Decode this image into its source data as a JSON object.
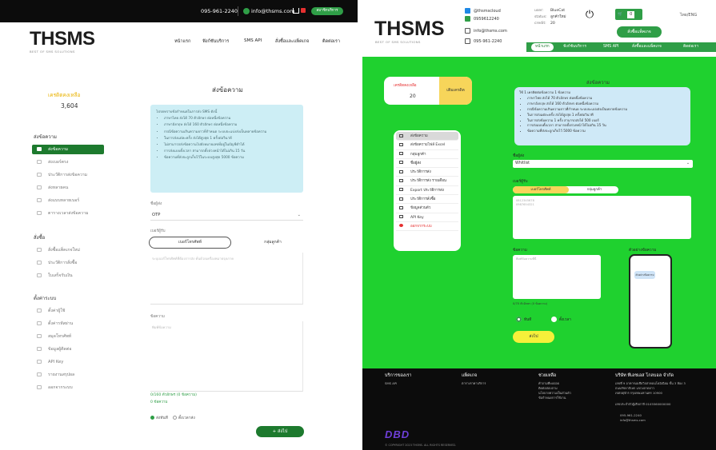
{
  "left": {
    "topbar": {
      "phone": "095-961-2240",
      "email": "info@thsms.com",
      "member_button": "สมาชิกบริการ"
    },
    "logo": "THSMS",
    "tagline": "BEST OF SMS SOLUTIONS",
    "nav": [
      "หน้าแรก",
      "ฟังก์ชันบริการ",
      "SMS API",
      "สั่งซื้อและแพ็คเกจ",
      "ติดต่อเรา"
    ],
    "credit": {
      "label": "เครดิตคงเหลือ",
      "value": "3,604"
    },
    "sidebar": {
      "group1": "ส่งข้อความ",
      "items1": [
        "ส่งข้อความ",
        "ส่งเบอร์ตรง",
        "ประวัติการส่งข้อความ",
        "ส่งหลายคน",
        "ส่งแบบหลายเบอร์",
        "ตารางเวลาส่งข้อความ"
      ],
      "group2": "สั่งซื้อ",
      "items2": [
        "สั่งซื้อแพ็คเกจใหม่",
        "ประวัติการสั่งซื้อ",
        "ใบเสร็จรับเงิน"
      ],
      "group3": "ตั้งค่าระบบ",
      "items3": [
        "ตั้งค่าผู้ใช้",
        "ตั้งค่ารหัสผ่าน",
        "สมุดโทรศัพท์",
        "ข้อมูลผู้ติดต่อ",
        "API Key",
        "รายงานสรุปผล",
        "ออกจากระบบ"
      ]
    },
    "main": {
      "title": "ส่งข้อความ",
      "info_lines": [
        "โปรดทราบข้อกำหนดในการส่ง SMS ดังนี้",
        "ภาษาไทย ส่งได้ 70 ตัวอักษร ต่อหนึ่งข้อความ",
        "ภาษาอังกฤษ ส่งได้ 160 ตัวอักษร ต่อหนึ่งข้อความ",
        "กรณีข้อความเกินความยาวที่กำหนด ระบบจะแบ่งส่งเป็นหลายข้อความ",
        "ในการส่งแต่ละครั้ง ส่งได้สูงสุด 1 ครั้งต่อวินาที",
        "ไม่สามารถส่งข้อความไปยังหมายเลขที่อยู่ในบัญชีดำได้",
        "การส่งแบบตั้งเวลา สามารถตั้งล่วงหน้าได้ไม่เกิน 15 วัน",
        "ข้อความที่ส่งจะถูกเก็บไว้ในระบบสูงสุด 5000 ข้อความ"
      ],
      "sender_label": "ชื่อผู้ส่ง",
      "sender_value": "OTP",
      "recipient_label": "เบอร์ผู้รับ",
      "seg_a": "เบอร์โทรศัพท์",
      "seg_b": "กลุ่มลูกค้า",
      "recipients_placeholder": "ระบุเบอร์โทรศัพท์ที่ต้องการส่ง คั่นด้วยเครื่องหมายจุลภาค",
      "message_label": "ข้อความ",
      "message_placeholder": "พิมพ์ข้อความ",
      "count_line1": "0/160 ตัวอักษร (0 ข้อความ)",
      "count_line2": "0 ข้อความ",
      "radio_now": "ส่งทันที",
      "radio_schedule": "ตั้งเวลาส่ง",
      "send_button": "+ ส่งไป"
    }
  },
  "right": {
    "logo": "THSMS",
    "tagline": "BEST OF SMS SOLUTIONS",
    "contacts": [
      "@thsmscloud",
      "0959612240",
      "info@thsms.com",
      "095-961-2240"
    ],
    "account": {
      "user_label": "user:",
      "user_value": "BlueCat",
      "status_label": "status:",
      "status_value": "ลูกค้าใหม่",
      "credit_label": "credit:",
      "credit_value": "20"
    },
    "count_badge": "0",
    "lang": "ไทย/ENG",
    "cta": "สั่งซื้อแพ็คเกจ",
    "navbar": [
      "หน้าแรก",
      "ฟังก์ชันบริการ",
      "SMS API",
      "สั่งซื้อและแพ็คเกจ",
      "ติดต่อเรา"
    ],
    "credit": {
      "label": "เครดิตคงเหลือ",
      "value": "20",
      "buy": "เติมเครดิต"
    },
    "menu": [
      "ส่งข้อความ",
      "ส่งข้อความไฟล์ Excel",
      "กลุ่มลูกค้า",
      "ชื่อผู้ส่ง",
      "ประวัติการส่ง",
      "ประวัติการส่ง รายเดือน",
      "Export ประวัติการส่ง",
      "ประวัติการสั่งซื้อ",
      "ข้อมูลส่วนตัว",
      "API Key",
      "ออกจากระบบ"
    ],
    "main": {
      "title": "ส่งข้อความ",
      "info_lines": [
        "ใช้ 1 เครดิตต่อข้อความ 1 ข้อความ",
        "ภาษาไทย ส่งได้ 70 ตัวอักษร ต่อหนึ่งข้อความ",
        "ภาษาอังกฤษ ส่งได้ 160 ตัวอักษร ต่อหนึ่งข้อความ",
        "กรณีข้อความเกินความยาวที่กำหนด ระบบจะแบ่งส่งเป็นหลายข้อความ",
        "ในการส่งแต่ละครั้ง ส่งได้สูงสุด 1 ครั้งต่อวินาที",
        "ในการส่งข้อความ 1 ครั้ง สามารถส่งได้ 500 เบอร์",
        "การส่งแบบตั้งเวลา สามารถตั้งล่วงหน้าได้ไม่เกิน 15 วัน",
        "ข้อความที่ส่งจะถูกเก็บไว้ 5000 ข้อความ"
      ],
      "sender_label": "ชื่อผู้ส่ง",
      "sender_value": "Whitlist",
      "recipient_label": "เบอร์ผู้รับ",
      "seg_a": "เบอร์โทรศัพท์",
      "seg_b": "กลุ่มลูกค้า",
      "recipients_placeholder_1": "0812345678",
      "recipients_placeholder_2": "0987654321",
      "message_label": "ข้อความ",
      "message_placeholder": "พิมพ์ข้อความที่นี่",
      "preview_label": "ตัวอย่างข้อความ",
      "preview_bubble": "ตัวอย่างข้อความ",
      "note": "0/70 ตัวอักษร (0 ข้อความ)",
      "radio_now": "ทันที",
      "radio_schedule": "ตั้งเวลา",
      "send_button": "ส่งไป"
    },
    "footer": {
      "col1_head": "บริการของเรา",
      "col1": [
        "SMS API"
      ],
      "col2_head": "แพ็คเกจ",
      "col2": [
        "ตารางราคาบริการ"
      ],
      "col3_head": "ช่วยเหลือ",
      "col3": [
        "คำถามที่พบบ่อย",
        "ติดต่อสอบถาม",
        "นโยบายความเป็นส่วนตัว",
        "ข้อกำหนดการใช้งาน"
      ],
      "col4_head": "บริษัท ทีเอชเอส โกลบอล จำกัด",
      "col4": [
        "เลขที่ 9 อาคารเอเชียวิลล่าคอนโดมิเนียม ชั้น 3 ห้อง 3",
        "ถนนรัชดาภิเษก แขวงลาดยาว",
        "เขตจตุจักร กรุงเทพมหานคร 10900",
        "เลขประจำตัวผู้เสียภาษี 0105560000000",
        "095-961-2240",
        "info@thsms.com"
      ],
      "logo": "DBD",
      "copyright": "© COPYRIGHT 2023 THSMS. ALL RIGHTS RESERVED."
    }
  }
}
